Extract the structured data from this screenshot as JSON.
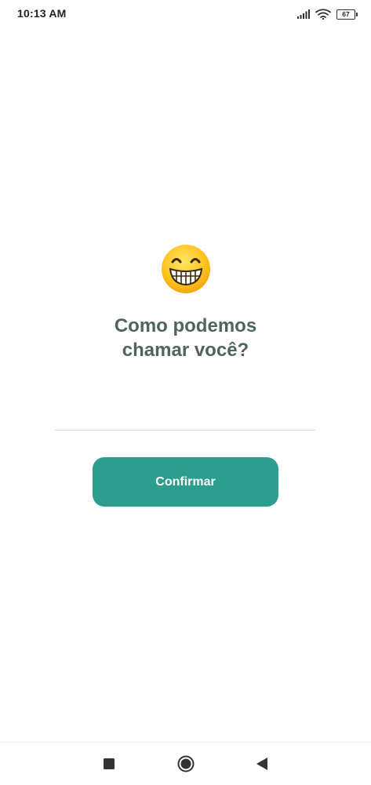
{
  "status_bar": {
    "time": "10:13 AM",
    "battery_level": "67",
    "icons": [
      "signal-icon",
      "wifi-icon",
      "battery-icon"
    ]
  },
  "main": {
    "emoji_icon": "grinning-face-with-smiling-eyes-icon",
    "title_line1": "Como podemos",
    "title_line2": "chamar você?",
    "name_input_value": "",
    "confirm_label": "Confirmar"
  },
  "nav_bar": {
    "icons": [
      "recents-square-icon",
      "home-circle-icon",
      "back-triangle-icon"
    ]
  },
  "colors": {
    "accent": "#2b9e8e",
    "title": "#4f6557",
    "divider": "#d9d9d9"
  }
}
